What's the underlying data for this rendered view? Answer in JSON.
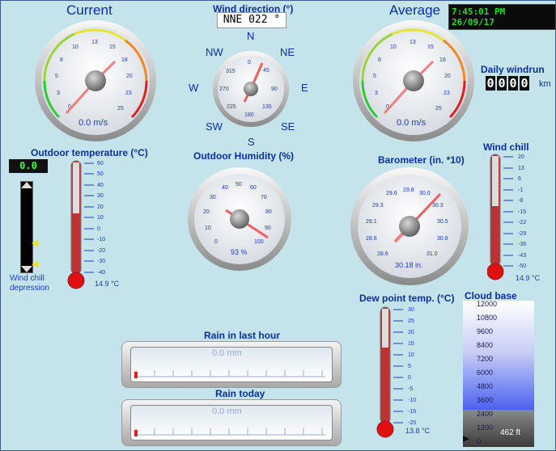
{
  "current": {
    "title": "Current",
    "value": "0.0 m/s",
    "ticks": [
      "0",
      "3",
      "5",
      "8",
      "10",
      "13",
      "15",
      "18",
      "20",
      "23",
      "25"
    ]
  },
  "average": {
    "title": "Average",
    "value": "0.0 m/s",
    "ticks": [
      "0",
      "3",
      "5",
      "8",
      "10",
      "13",
      "15",
      "18",
      "20",
      "23",
      "25"
    ]
  },
  "clock": "7:45:01 PM 26/09/17",
  "wind_direction": {
    "title": "Wind direction (°)",
    "value": "NNE  022 °",
    "compass": {
      "n": "N",
      "ne": "NE",
      "e": "E",
      "se": "SE",
      "s": "S",
      "sw": "SW",
      "w": "W",
      "nw": "NW"
    },
    "ticks": [
      "0",
      "45",
      "90",
      "135",
      "180",
      "225",
      "270",
      "315"
    ]
  },
  "daily_windrun": {
    "title": "Daily windrun",
    "digits": [
      "0",
      "0",
      "0",
      "0"
    ],
    "unit": "km"
  },
  "outdoor_temperature": {
    "title": "Outdoor temperature (°C)",
    "lcd": "0.0",
    "value": "14.9 °C",
    "ticks": [
      "60",
      "50",
      "40",
      "30",
      "20",
      "10",
      "0",
      "-10",
      "-20",
      "-30",
      "-40"
    ],
    "level": 0.61
  },
  "wind_chill_depression": {
    "label_line1": "Wind chill",
    "label_line2": "depression"
  },
  "outdoor_humidity": {
    "title": "Outdoor Humidity (%)",
    "value": "93 %",
    "ticks": [
      "0",
      "10",
      "20",
      "30",
      "40",
      "50",
      "60",
      "70",
      "80",
      "90",
      "100"
    ]
  },
  "barometer": {
    "title": "Barometer (in. *10)",
    "value": "30.18 in.",
    "ticks": [
      "28.6",
      "28.8",
      "29.1",
      "29.3",
      "29.6",
      "29.8",
      "30.0",
      "30.3",
      "30.5",
      "30.8",
      "31.0"
    ]
  },
  "wind_chill": {
    "title": "Wind chill",
    "value": "14.9 °C",
    "ticks": [
      "20",
      "13",
      "6",
      "-1",
      "-8",
      "-15",
      "-22",
      "-29",
      "-36",
      "-43",
      "-50"
    ],
    "level": 0.55
  },
  "dew_point": {
    "title": "Dew point temp. (°C)",
    "value": "13.8 °C",
    "ticks": [
      "30",
      "25",
      "20",
      "15",
      "10",
      "5",
      "0",
      "-5",
      "-10",
      "-15",
      "-20"
    ],
    "level": 0.68
  },
  "cloud_base": {
    "title": "Cloud base",
    "ticks": [
      "12000",
      "10800",
      "9600",
      "8400",
      "7200",
      "6000",
      "4800",
      "3600",
      "2400",
      "1200",
      "0"
    ],
    "value": "462 ft"
  },
  "rain_last_hour": {
    "title": "Rain in last hour",
    "value": "0.0 mm"
  },
  "rain_today": {
    "title": "Rain today",
    "value": "0.0 mm"
  }
}
